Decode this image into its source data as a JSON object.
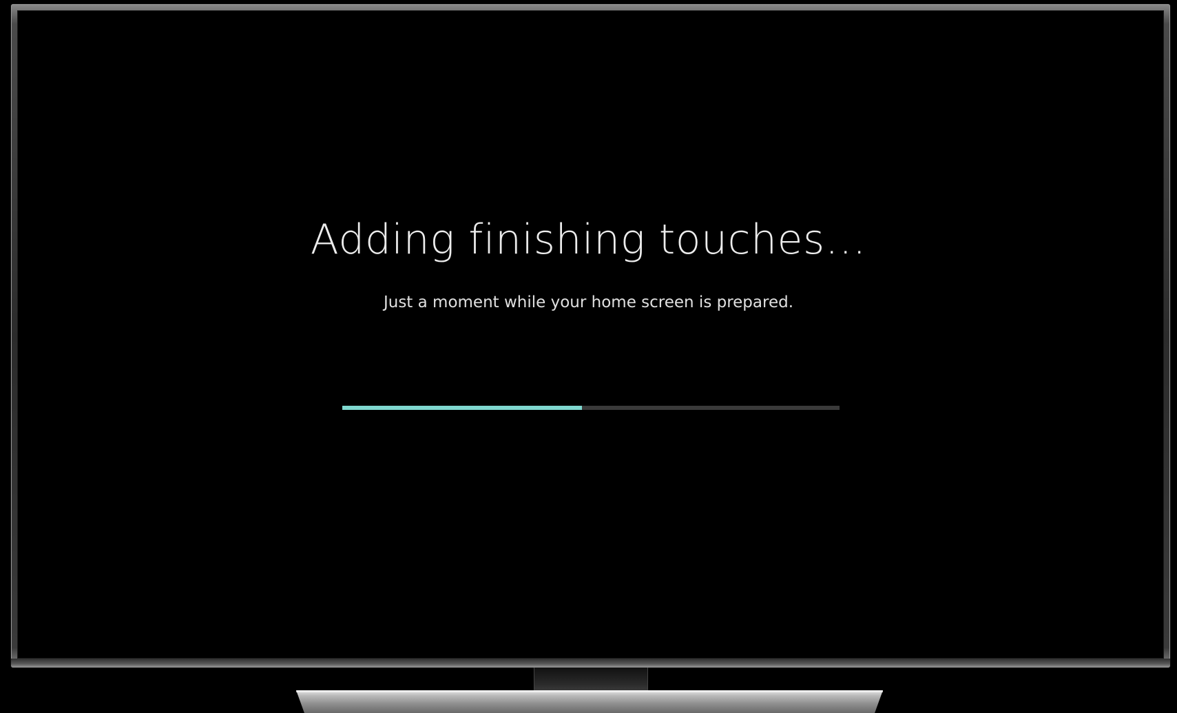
{
  "screen": {
    "title": "Adding finishing touches…",
    "subtitle": "Just a moment while your home screen is prepared."
  },
  "progress": {
    "fraction": 0.482,
    "fill_color": "#7fd8cf",
    "track_color": "#3a3a3a"
  }
}
